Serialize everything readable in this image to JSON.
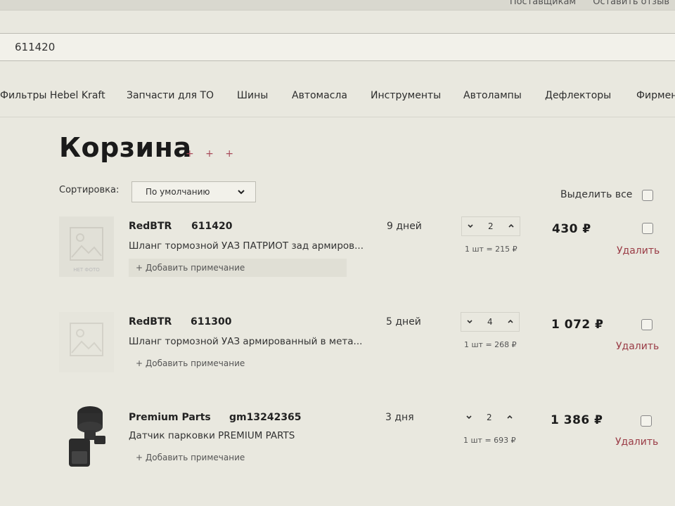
{
  "topbar": {
    "links": [
      "Поставщикам",
      "Оставить отзыв"
    ]
  },
  "search": {
    "value": "611420"
  },
  "nav": {
    "items": [
      "Фильтры Hebel Kraft",
      "Запчасти для ТО",
      "Шины",
      "Автомасла",
      "Инструменты",
      "Автолампы",
      "Дефлекторы",
      "Фирмен"
    ]
  },
  "cart": {
    "title": "Корзина",
    "title_dots": "+ + +",
    "sort_label": "Сортировка:",
    "sort_value": "По умолчанию",
    "select_all": "Выделить все",
    "items": [
      {
        "brand": "RedBTR",
        "article": "611420",
        "description": "Шланг тормозной УАЗ ПАТРИОТ зад армиров...",
        "note": "+ Добавить примечание",
        "days": "9 дней",
        "qty": "2",
        "unit_price": "1 шт = 215 ₽",
        "price": "430 ₽",
        "delete": "Удалить",
        "thumb_caption": "НЕТ ФОТО"
      },
      {
        "brand": "RedBTR",
        "article": "611300",
        "description": "Шланг тормозной УАЗ армированный в мета...",
        "note": "+ Добавить примечание",
        "days": "5 дней",
        "qty": "4",
        "unit_price": "1 шт = 268 ₽",
        "price": "1 072 ₽",
        "delete": "Удалить"
      },
      {
        "brand": "Premium Parts",
        "article": "gm13242365",
        "description": "Датчик парковки PREMIUM PARTS",
        "note": "+ Добавить примечание",
        "days": "3 дня",
        "qty": "2",
        "unit_price": "1 шт = 693 ₽",
        "price": "1 386 ₽",
        "delete": "Удалить"
      }
    ]
  },
  "colors": {
    "background": "#e9e8df",
    "delete_link": "#9a3c46",
    "accent_dots": "#a84a5a"
  }
}
